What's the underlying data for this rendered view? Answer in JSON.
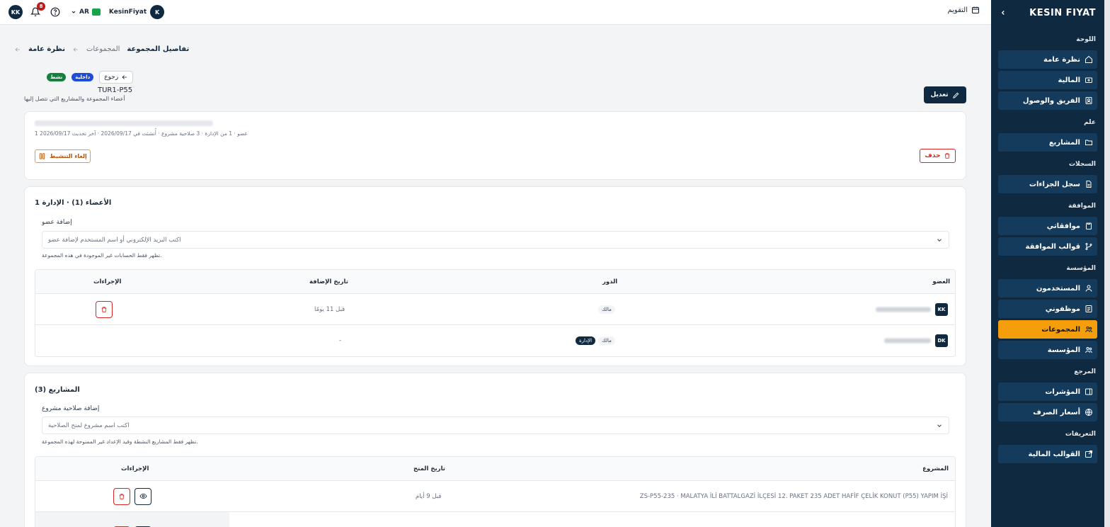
{
  "topbar": {
    "user_initials": "KK",
    "notifications_count": "8",
    "language": "AR",
    "username": "KesinFiyat",
    "user_avatar_letter": "K",
    "calendar_label": "التقويم"
  },
  "sidebar": {
    "brand": "KESIN FIYAT",
    "sections": {
      "dashboard": "اللوحة",
      "general": "علم",
      "records": "السجلات",
      "approval": "الموافقة",
      "organization": "المؤسسة",
      "reference": "المرجع",
      "definitions": "التعريفات"
    },
    "items": {
      "overview": "نظرة عامة",
      "finance": "المالية",
      "team": "الفريق والوصول",
      "projects": "المشاريع",
      "penalties": "سجل الجزاءات",
      "my_approvals": "موافقاتي",
      "approval_templates": "قوالب الموافقة",
      "users": "المستخدمون",
      "my_employees": "موظفوني",
      "groups": "المجموعات",
      "organization": "المؤسسة",
      "indicators": "المؤشرات",
      "exchange_rates": "أسعار الصرف",
      "financial_templates": "القوالب المالية"
    }
  },
  "breadcrumb": {
    "overview": "نظرة عامة",
    "groups": "المجموعات",
    "current": "تفاصيل المجموعة"
  },
  "header": {
    "back_label": "رجوع",
    "badge_internal": "داخلية",
    "badge_active": "نشط",
    "code": "TUR1-P55",
    "subtitle": "أعضاء المجموعة والمشاريع التي تتصل إليها",
    "edit_label": "تعديل"
  },
  "summary": {
    "meta": "عضو · 1 من الإدارة · 3 صلاحية مشروع · أُنشئت في 2026/09/17 · آخر تحديث 2026/09/17 1",
    "deactivate_label": "إلغاء التنشيط",
    "delete_label": "حذف"
  },
  "members": {
    "title": "الأعضاء (1) · الإدارة 1",
    "add_label": "إضافة عضو",
    "placeholder": "اكتب البريد الإلكتروني أو اسم المستخدم لإضافة عضو",
    "hint": "تظهر فقط الحسابات غير الموجودة في هذه المجموعة.",
    "columns": {
      "member": "العضو",
      "role": "الدور",
      "added": "تاريخ الإضافة",
      "actions": "الإجراءات"
    },
    "rows": [
      {
        "initials": "KK",
        "role": "مالك",
        "admin": "",
        "added": "قبل 11 يومًا"
      },
      {
        "initials": "DK",
        "role": "مالك",
        "admin": "الإدارة",
        "added": "-"
      }
    ]
  },
  "projects": {
    "title": "المشاريع (3)",
    "add_label": "إضافة صلاحية مشروع",
    "placeholder": "اكتب اسم مشروع لمنح الصلاحية",
    "hint": "تظهر فقط المشاريع النشطة وقيد الإعداد غير الممنوحة لهذه المجموعة.",
    "columns": {
      "project": "المشروع",
      "granted": "تاريخ المنح",
      "actions": "الإجراءات"
    },
    "rows": [
      {
        "name": "ZS-P55-235 · MALATYA İLİ BATTALGAZİ İLÇESİ 12. PAKET 235 ADET HAFİF ÇELİK KONUT (P55) YAPIM İŞİ",
        "granted": "قبل 9 أيام"
      }
    ]
  },
  "colors": {
    "navy": "#0f2940",
    "accent": "#f59e0b",
    "danger": "#dc2626",
    "success": "#15803d"
  }
}
